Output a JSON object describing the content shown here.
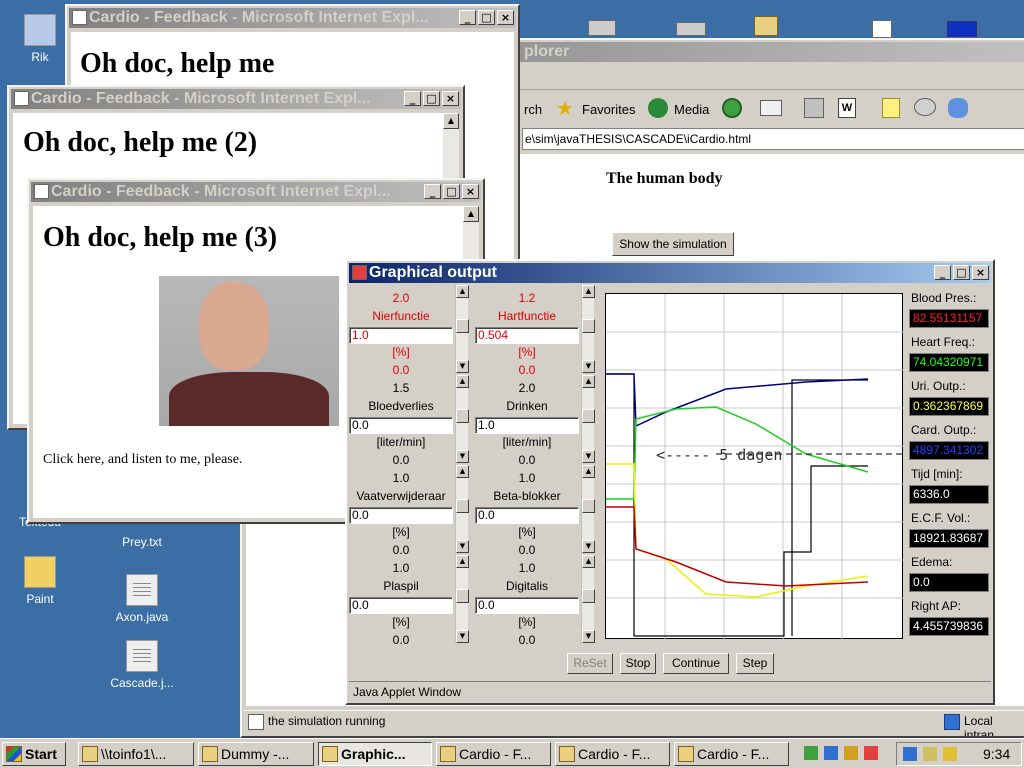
{
  "desktop": {
    "icons": [
      {
        "label": "Rik"
      },
      {
        "label": "Prey.txt"
      },
      {
        "label": "Axon.java"
      },
      {
        "label": "Cascade.j..."
      },
      {
        "label": "Paint"
      },
      {
        "label": "Textedu"
      }
    ]
  },
  "ie_main": {
    "title_fragment": "plorer",
    "toolbar": {
      "search": "rch",
      "favorites": "Favorites",
      "media": "Media"
    },
    "address": "e\\sim\\javaTHESIS\\CASCADE\\iCardio.html",
    "page_heading": "The human body",
    "show_button": "Show the simulation",
    "status_text": "the simulation running",
    "status_zone": "Local intran"
  },
  "feedback1": {
    "title": "Cardio - Feedback - Microsoft Internet Expl...",
    "heading": "Oh doc, help me"
  },
  "feedback2": {
    "title": "Cardio - Feedback - Microsoft Internet Expl...",
    "heading": "Oh doc, help me (2)"
  },
  "feedback3": {
    "title": "Cardio - Feedback - Microsoft Internet Expl...",
    "heading": "Oh doc, help me (3)",
    "link_text": "Click here, and listen to me, please."
  },
  "graph": {
    "title": "Graphical output",
    "footer": "Java Applet Window",
    "left_col": [
      {
        "max": "2.0",
        "name": "Nierfunctie",
        "value": "1.0",
        "unit": "[%]",
        "min": "0.0",
        "red": true
      },
      {
        "max": "1.5",
        "name": "Bloedverlies",
        "value": "0.0",
        "unit": "[liter/min]",
        "min": "0.0",
        "red": false
      },
      {
        "max": "1.0",
        "name": "Vaatverwijderaar",
        "value": "0.0",
        "unit": "[%]",
        "min": "0.0",
        "red": false
      },
      {
        "max": "1.0",
        "name": "Plaspil",
        "value": "0.0",
        "unit": "[%]",
        "min": "0.0",
        "red": false
      }
    ],
    "right_col": [
      {
        "max": "1.2",
        "name": "Hartfunctie",
        "value": "0.504",
        "unit": "[%]",
        "min": "0.0",
        "red": true
      },
      {
        "max": "2.0",
        "name": "Drinken",
        "value": "1.0",
        "unit": "[liter/min]",
        "min": "0.0",
        "red": false
      },
      {
        "max": "1.0",
        "name": "Beta-blokker",
        "value": "0.0",
        "unit": "[%]",
        "min": "0.0",
        "red": false
      },
      {
        "max": "1.0",
        "name": "Digitalis",
        "value": "0.0",
        "unit": "[%]",
        "min": "0.0",
        "red": false
      }
    ],
    "annotation": "<----- 5 dagen",
    "buttons": {
      "reset": "ReSet",
      "stop": "Stop",
      "continue": "Continue",
      "step": "Step"
    },
    "readouts": [
      {
        "label": "Blood Pres.:",
        "value": "82.55131157",
        "color": "#ff2020"
      },
      {
        "label": "Heart Freq.:",
        "value": "74.04320971",
        "color": "#20ff20"
      },
      {
        "label": "Uri. Outp.:",
        "value": "0.362367869",
        "color": "#ffff40"
      },
      {
        "label": "Card. Outp.:",
        "value": "4897.341302",
        "color": "#2040ff"
      },
      {
        "label": "Tijd [min]:",
        "value": "6336.0",
        "color": "#ffffff"
      },
      {
        "label": "E.C.F. Vol.:",
        "value": "18921.83687",
        "color": "#ffffff"
      },
      {
        "label": "Edema:",
        "value": "0.0",
        "color": "#ffffff"
      },
      {
        "label": "Right AP:",
        "value": "4.455739836",
        "color": "#ffffff"
      }
    ]
  },
  "taskbar": {
    "start": "Start",
    "tasks": [
      {
        "label": "\\\\toinfo1\\..."
      },
      {
        "label": "Dummy -..."
      },
      {
        "label": "Graphic..."
      },
      {
        "label": "Cardio - F..."
      },
      {
        "label": "Cardio - F..."
      },
      {
        "label": "Cardio - F..."
      }
    ],
    "clock": "9:34"
  }
}
